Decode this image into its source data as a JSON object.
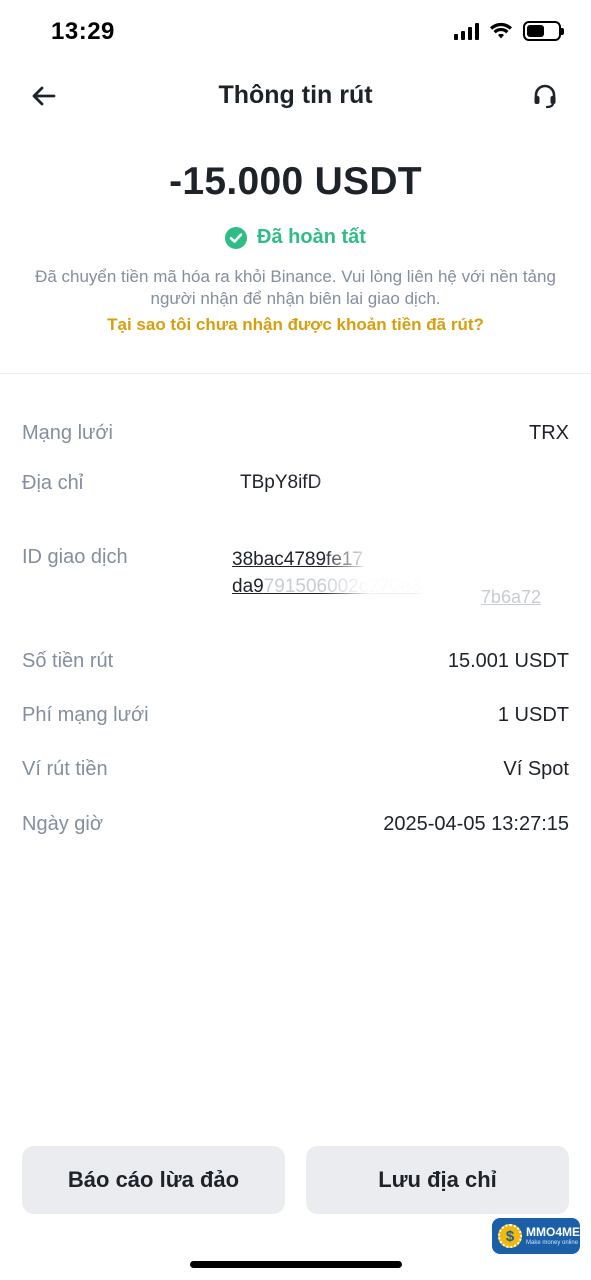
{
  "status_bar": {
    "time": "13:29",
    "battery_level": 0.55
  },
  "header": {
    "title": "Thông tin rút",
    "back_icon": "arrow-left-icon",
    "support_icon": "headset-icon"
  },
  "summary": {
    "amount": "-15.000 USDT",
    "status": "Đã hoàn tất",
    "status_color": "#2ebd85",
    "description": "Đã chuyển tiền mã hóa ra khỏi Binance. Vui lòng liên hệ với nền tảng người nhận để nhận biên lai giao dịch.",
    "help_link": "Tại sao tôi chưa nhận được khoản tiền đã rút?",
    "help_link_color": "#d89f0d"
  },
  "details": {
    "network": {
      "label": "Mạng lưới",
      "value": "TRX"
    },
    "address": {
      "label": "Địa chỉ",
      "value": "TBpY8ifD"
    },
    "txid": {
      "label": "ID giao dịch",
      "line1": "38bac4789fe17",
      "line2": "da9",
      "line2_faded": "791506002c270e3",
      "tail": "7b6a72"
    },
    "amount": {
      "label": "Số tiền rút",
      "value": "15.001 USDT"
    },
    "fee": {
      "label": "Phí mạng lưới",
      "value": "1 USDT"
    },
    "wallet": {
      "label": "Ví rút tiền",
      "value": "Ví Spot"
    },
    "datetime": {
      "label": "Ngày giờ",
      "value": "2025-04-05 13:27:15"
    }
  },
  "actions": {
    "report": "Báo cáo lừa đảo",
    "save_address": "Lưu địa chỉ"
  },
  "watermark": {
    "name": "MMO4ME",
    "tagline": "Make money online"
  }
}
